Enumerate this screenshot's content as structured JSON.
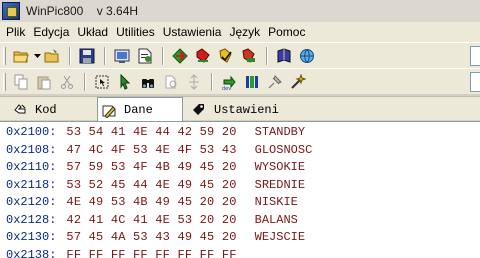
{
  "window": {
    "title": "WinPic800    v 3.64H"
  },
  "menu": [
    "Plik",
    "Edycja",
    "Układ",
    "Utilities",
    "Ustawienia",
    "Język",
    "Pomoc"
  ],
  "tabs": [
    {
      "label": "Kod",
      "icon": "code-hand-icon",
      "active": false
    },
    {
      "label": "Dane",
      "icon": "data-edit-icon",
      "active": true
    },
    {
      "label": "Ustawieni",
      "icon": "settings-tag-icon",
      "active": false
    }
  ],
  "data_rows": [
    {
      "addr": "0x2100:",
      "hex": "53 54 41 4E 44 42 59 20",
      "ascii": "STANDBY"
    },
    {
      "addr": "0x2108:",
      "hex": "47 4C 4F 53 4E 4F 53 43",
      "ascii": "GLOSNOSC"
    },
    {
      "addr": "0x2110:",
      "hex": "57 59 53 4F 4B 49 45 20",
      "ascii": "WYSOKIE"
    },
    {
      "addr": "0x2118:",
      "hex": "53 52 45 44 4E 49 45 20",
      "ascii": "SREDNIE"
    },
    {
      "addr": "0x2120:",
      "hex": "4E 49 53 4B 49 45 20 20",
      "ascii": "NISKIE"
    },
    {
      "addr": "0x2128:",
      "hex": "42 41 4C 41 4E 53 20 20",
      "ascii": "BALANS"
    },
    {
      "addr": "0x2130:",
      "hex": "57 45 4A 53 43 49 45 20",
      "ascii": "WEJSCIE"
    },
    {
      "addr": "0x2138:",
      "hex": "FF FF FF FF FF FF FF FF",
      "ascii": ""
    }
  ],
  "colors": {
    "address": "#0a2a8c",
    "data": "#7a1616",
    "chrome": "#ece9d8"
  },
  "toolbar1_icons": [
    "open-folder-icon",
    "chevron-down-icon",
    "open-file-icon",
    "save-disk-icon",
    "hardware-config-icon",
    "file-report-icon",
    "read-device-icon",
    "erase-device-icon",
    "verify-device-icon",
    "write-device-icon",
    "help-book-icon",
    "globe-icon"
  ],
  "toolbar2_icons": [
    "copy-icon",
    "paste-icon",
    "cut-icon",
    "select-all-icon",
    "cursor-icon",
    "find-binoculars-icon",
    "replace-icon",
    "goto-icon",
    "detect-device-icon",
    "device-list-icon",
    "pin-icon",
    "settings-wand-icon"
  ]
}
